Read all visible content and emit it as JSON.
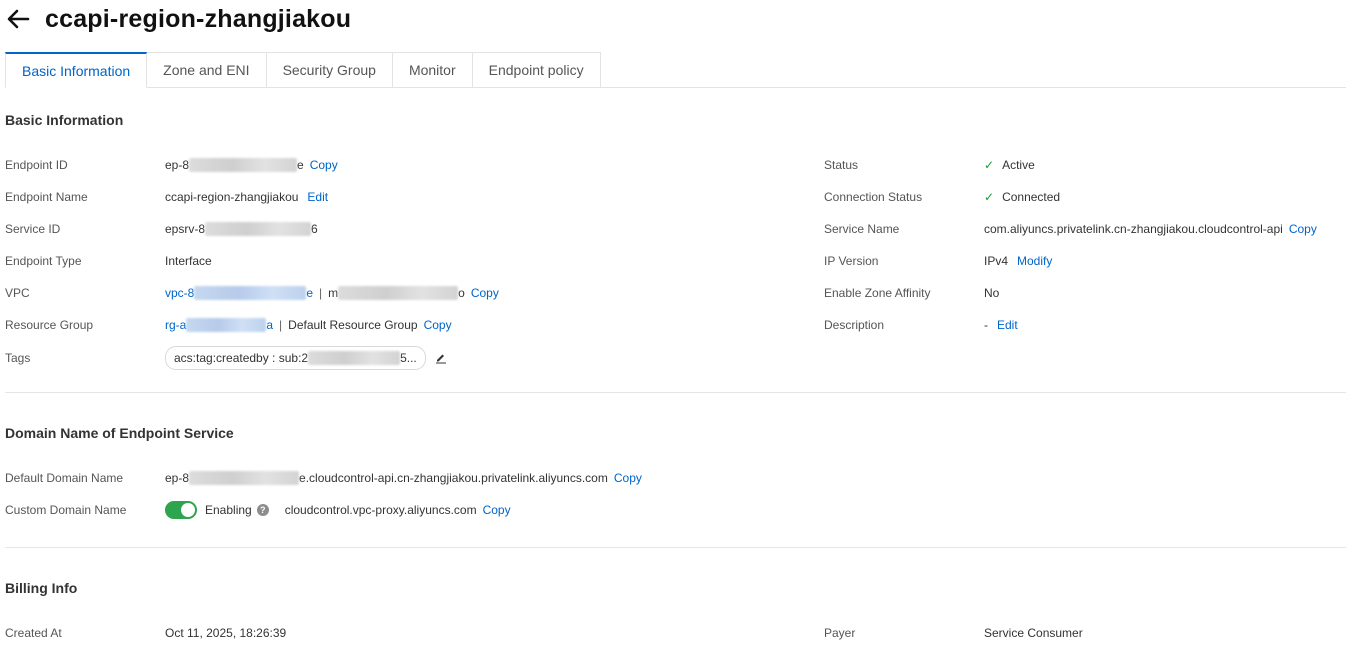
{
  "header": {
    "title": "ccapi-region-zhangjiakou"
  },
  "tabs": [
    {
      "label": "Basic Information",
      "active": true
    },
    {
      "label": "Zone and ENI"
    },
    {
      "label": "Security Group"
    },
    {
      "label": "Monitor"
    },
    {
      "label": "Endpoint policy"
    }
  ],
  "basic": {
    "title": "Basic Information",
    "endpoint_id": {
      "label": "Endpoint ID",
      "prefix": "ep-8",
      "suffix": "e",
      "action": "Copy"
    },
    "endpoint_name": {
      "label": "Endpoint Name",
      "value": "ccapi-region-zhangjiakou",
      "action": "Edit"
    },
    "service_id": {
      "label": "Service ID",
      "prefix": "epsrv-8",
      "suffix": "6"
    },
    "endpoint_type": {
      "label": "Endpoint Type",
      "value": "Interface"
    },
    "vpc": {
      "label": "VPC",
      "link_prefix": "vpc-8",
      "link_suffix": "e",
      "separator": "|",
      "name_prefix": "m",
      "name_suffix": "o",
      "action": "Copy"
    },
    "resource_group": {
      "label": "Resource Group",
      "link_prefix": "rg-a",
      "link_suffix": "a",
      "separator": "|",
      "name": "Default Resource Group",
      "action": "Copy"
    },
    "tags": {
      "label": "Tags",
      "prefix": "acs:tag:createdby : sub:2",
      "suffix": "5..."
    },
    "status": {
      "label": "Status",
      "value": "Active"
    },
    "connection_status": {
      "label": "Connection Status",
      "value": "Connected"
    },
    "service_name": {
      "label": "Service Name",
      "value": "com.aliyuncs.privatelink.cn-zhangjiakou.cloudcontrol-api",
      "action": "Copy"
    },
    "ip_version": {
      "label": "IP Version",
      "value": "IPv4",
      "action": "Modify"
    },
    "zone_affinity": {
      "label": "Enable Zone Affinity",
      "value": "No"
    },
    "description": {
      "label": "Description",
      "value": "-",
      "action": "Edit"
    }
  },
  "domain": {
    "title": "Domain Name of Endpoint Service",
    "default_domain": {
      "label": "Default Domain Name",
      "prefix": "ep-8",
      "suffix": "e.cloudcontrol-api.cn-zhangjiakou.privatelink.aliyuncs.com",
      "action": "Copy"
    },
    "custom_domain": {
      "label": "Custom Domain Name",
      "toggle_label": "Enabling",
      "value": "cloudcontrol.vpc-proxy.aliyuncs.com",
      "action": "Copy",
      "enabled": true
    }
  },
  "billing": {
    "title": "Billing Info",
    "created_at": {
      "label": "Created At",
      "value": "Oct 11, 2025, 18:26:39"
    },
    "payer": {
      "label": "Payer",
      "value": "Service Consumer"
    }
  },
  "colors": {
    "accent": "#0064c8",
    "success": "#1a9d3a",
    "toggle_on": "#2da44e"
  }
}
